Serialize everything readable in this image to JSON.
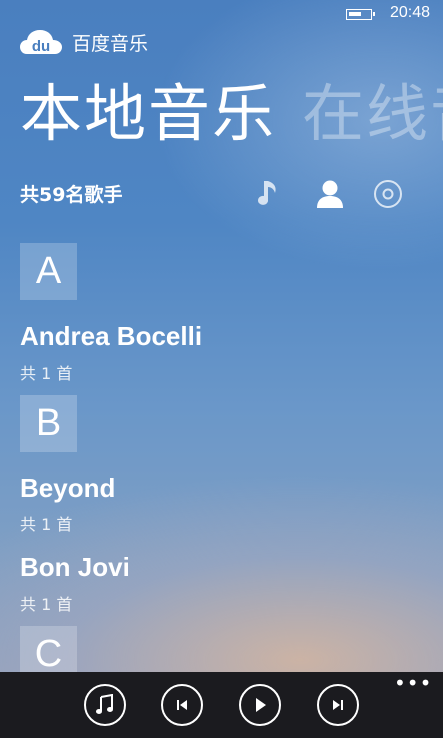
{
  "status": {
    "time": "20:48"
  },
  "app": {
    "name": "百度音乐"
  },
  "pivot": {
    "active": "本地音乐",
    "next": "在线音"
  },
  "summary": {
    "prefix": "共",
    "count": "59",
    "suffix": "名歌手"
  },
  "tabs": [
    {
      "name": "songs",
      "icon": "music-note-icon"
    },
    {
      "name": "artists",
      "icon": "person-icon",
      "selected": true
    },
    {
      "name": "albums",
      "icon": "disc-icon"
    }
  ],
  "groups": [
    {
      "letter": "A",
      "artists": [
        {
          "name": "Andrea Bocelli",
          "count": "共 1 首"
        }
      ]
    },
    {
      "letter": "B",
      "artists": [
        {
          "name": "Beyond",
          "count": "共 1 首"
        },
        {
          "name": "Bon Jovi",
          "count": "共 1 首"
        }
      ]
    },
    {
      "letter": "C",
      "artists": []
    }
  ],
  "appbar": {
    "buttons": [
      "music-note-icon",
      "previous-icon",
      "play-icon",
      "next-icon"
    ],
    "more": "•••"
  }
}
